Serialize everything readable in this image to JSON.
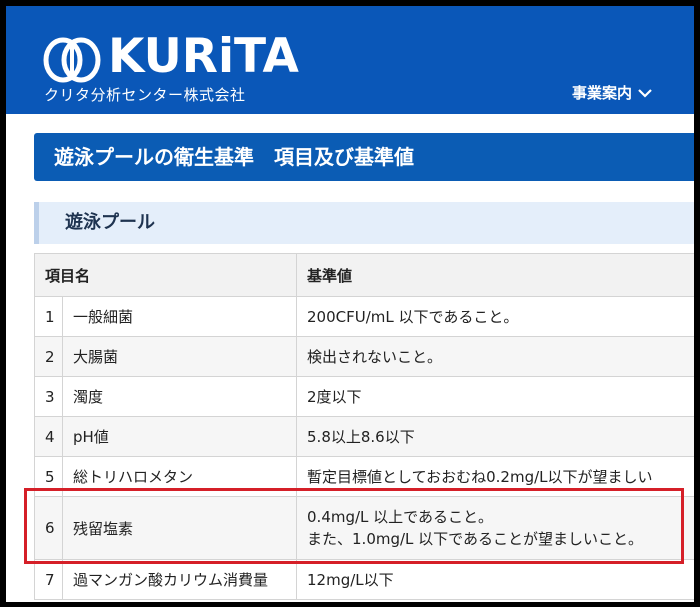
{
  "header": {
    "logo_text": "KURiTA",
    "subtitle": "クリタ分析センター株式会社",
    "nav_label": "事業案内"
  },
  "page_title": "遊泳プールの衛生基準　項目及び基準値",
  "section_title": "遊泳プール",
  "table": {
    "headers": [
      "項目名",
      "基準値"
    ],
    "rows": [
      {
        "no": "1",
        "name": "一般細菌",
        "lines": [
          "200CFU/mL 以下であること。"
        ]
      },
      {
        "no": "2",
        "name": "大腸菌",
        "lines": [
          "検出されないこと。"
        ]
      },
      {
        "no": "3",
        "name": "濁度",
        "lines": [
          "2度以下"
        ]
      },
      {
        "no": "4",
        "name": "pH値",
        "lines": [
          "5.8以上8.6以下"
        ]
      },
      {
        "no": "5",
        "name": "総トリハロメタン",
        "lines": [
          "暫定目標値としておおむね0.2mg/L以下が望ましい"
        ]
      },
      {
        "no": "6",
        "name": "残留塩素",
        "lines": [
          "0.4mg/L 以上であること。",
          "また、1.0mg/L 以下であることが望ましいこと。"
        ]
      },
      {
        "no": "7",
        "name": "過マンガン酸カリウム消費量",
        "lines": [
          "12mg/L以下"
        ]
      }
    ]
  },
  "colors": {
    "header_bg": "#0a57b8",
    "title_bg": "#0b5cb4",
    "section_bg": "#e4eefa",
    "highlight": "#d51f28"
  }
}
